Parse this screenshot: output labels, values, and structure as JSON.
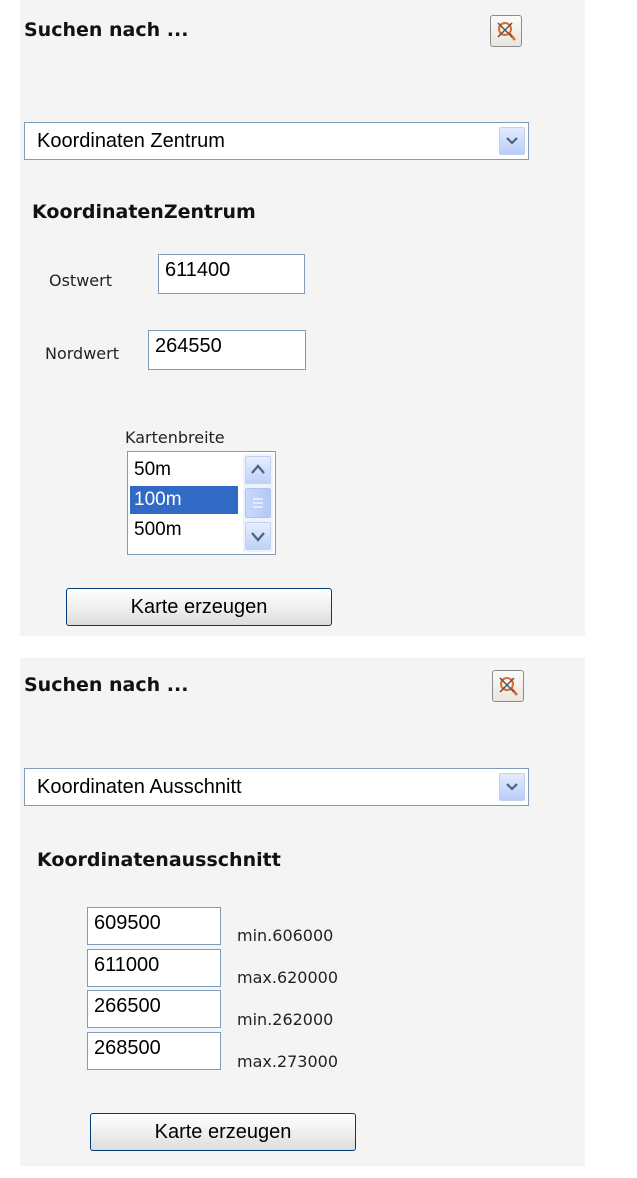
{
  "panel1": {
    "title": "Suchen nach ...",
    "select_value": "Koordinaten Zentrum",
    "section_heading": "KoordinatenZentrum",
    "ostwert_label": "Ostwert",
    "ostwert_value": "611400",
    "nordwert_label": "Nordwert",
    "nordwert_value": "264550",
    "kartenbreite_label": "Kartenbreite",
    "kartenbreite_options": [
      "50m",
      "100m",
      "500m"
    ],
    "kartenbreite_selected": "100m",
    "submit_label": "Karte erzeugen"
  },
  "panel2": {
    "title": "Suchen nach ...",
    "select_value": "Koordinaten Ausschnitt",
    "section_heading": "Koordinatenausschnitt",
    "fields": [
      {
        "value": "609500",
        "hint": "min.606000"
      },
      {
        "value": "611000",
        "hint": "max.620000"
      },
      {
        "value": "266500",
        "hint": "min.262000"
      },
      {
        "value": "268500",
        "hint": "max.273000"
      }
    ],
    "submit_label": "Karte erzeugen"
  },
  "icons": {
    "close": "close-map-icon",
    "dropdown": "chevron-down-icon",
    "scroll_up": "scroll-up-icon",
    "scroll_down": "scroll-down-icon"
  },
  "colors": {
    "selection": "#316ac5",
    "field_border": "#7f9db9",
    "button_border": "#003c74",
    "close_icon": "#e06a2a"
  }
}
